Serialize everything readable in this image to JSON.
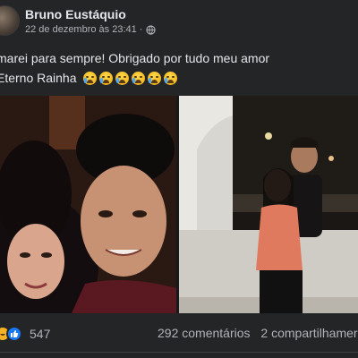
{
  "post": {
    "author": "Bruno Eustáquio",
    "timestamp": "22 de dezembro às 23:41 ·",
    "privacy_icon": "globe-icon",
    "caption_line1": "marei para sempre! Obrigado por tudo meu amor",
    "caption_line2": "Eterno Rainha",
    "caption_emoji": "crying-face",
    "caption_emoji_count": 6
  },
  "footer": {
    "reaction_count": "547",
    "comments": "292 comentários",
    "shares": "2 compartilhamer"
  },
  "colors": {
    "background": "#242526",
    "text": "#e4e6eb",
    "secondary_text": "#b0b3b8",
    "like_blue": "#1877f2",
    "haha_yellow": "#f7b125"
  }
}
